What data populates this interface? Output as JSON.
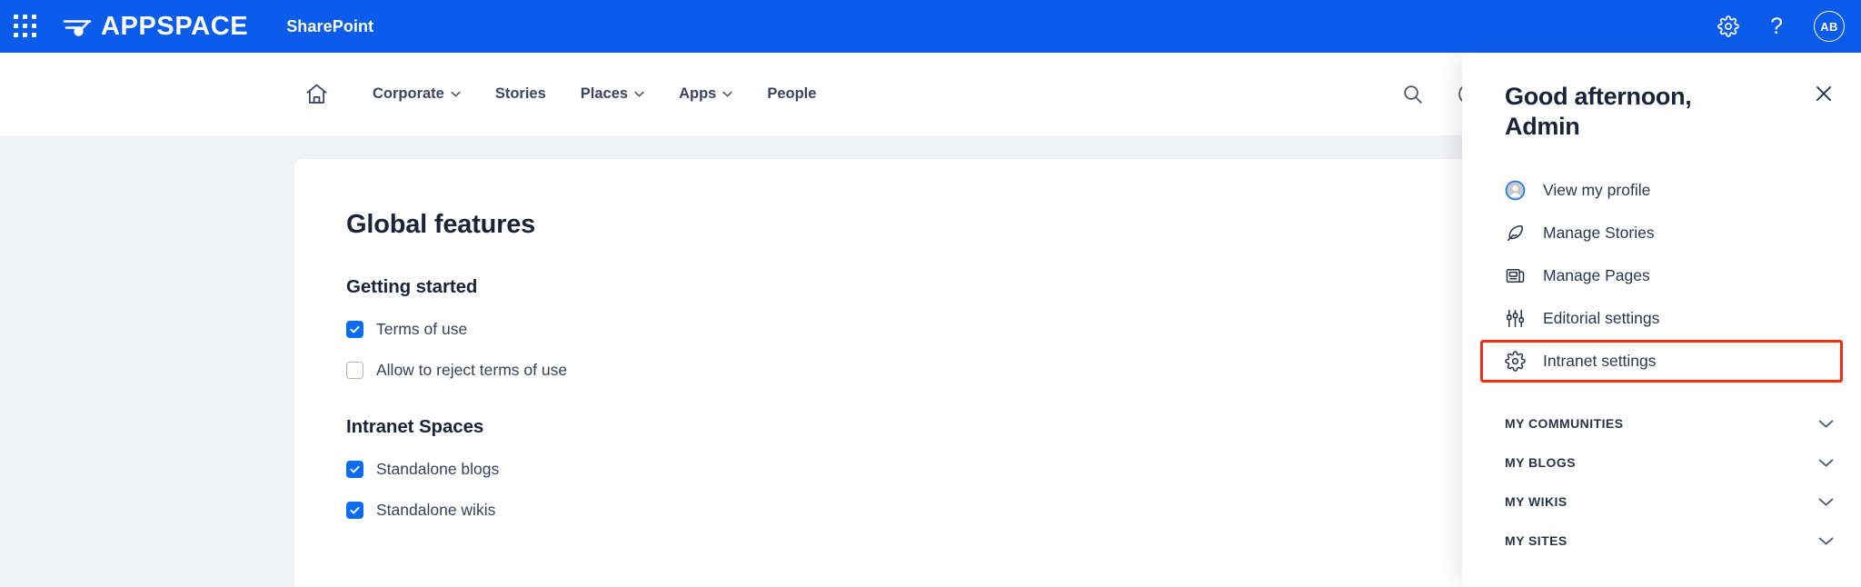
{
  "topbar": {
    "waffle_icon": "app-launcher-grid-icon",
    "brand_name": "APPSPACE",
    "brand_mark_icon": "appspace-swoosh-logo",
    "app_name": "SharePoint",
    "settings_icon": "gear-icon",
    "help_icon": "question-mark-icon",
    "help_glyph": "?",
    "avatar_initials": "AB",
    "bg_color": "#0c5ceb"
  },
  "navbar": {
    "home_icon": "home-icon",
    "links": [
      {
        "label": "Corporate",
        "has_caret": true
      },
      {
        "label": "Stories",
        "has_caret": false
      },
      {
        "label": "Places",
        "has_caret": true
      },
      {
        "label": "Apps",
        "has_caret": true
      },
      {
        "label": "People",
        "has_caret": false
      }
    ],
    "search_icon": "search-icon",
    "add_icon": "plus-circle-icon"
  },
  "content": {
    "page_title": "Global features",
    "sections": [
      {
        "title": "Getting started",
        "options": [
          {
            "label": "Terms of use",
            "checked": true
          },
          {
            "label": "Allow to reject terms of use",
            "checked": false
          }
        ]
      },
      {
        "title": "Intranet Spaces",
        "options": [
          {
            "label": "Standalone blogs",
            "checked": true
          },
          {
            "label": "Standalone wikis",
            "checked": true
          }
        ]
      }
    ]
  },
  "panel": {
    "greeting_line1": "Good afternoon,",
    "greeting_line2": "Admin",
    "close_icon": "close-icon",
    "menu": [
      {
        "label": "View my profile",
        "icon": "user-avatar-icon",
        "highlighted": false
      },
      {
        "label": "Manage Stories",
        "icon": "feather-pen-icon",
        "highlighted": false
      },
      {
        "label": "Manage Pages",
        "icon": "pages-news-icon",
        "highlighted": false
      },
      {
        "label": "Editorial settings",
        "icon": "sliders-icon",
        "highlighted": false
      },
      {
        "label": "Intranet settings",
        "icon": "gear-icon",
        "highlighted": true
      }
    ],
    "sections": [
      {
        "label": "MY COMMUNITIES",
        "chevron": "chevron-down-icon"
      },
      {
        "label": "MY BLOGS",
        "chevron": "chevron-down-icon"
      },
      {
        "label": "MY WIKIS",
        "chevron": "chevron-down-icon"
      },
      {
        "label": "MY SITES",
        "chevron": "chevron-down-icon"
      }
    ]
  },
  "colors": {
    "brand_blue": "#0c5ceb",
    "accent_blue": "#0c6cf2",
    "highlight_red": "#f62f11",
    "text_dark": "#1c2238",
    "page_bg": "#f1f2f5"
  }
}
